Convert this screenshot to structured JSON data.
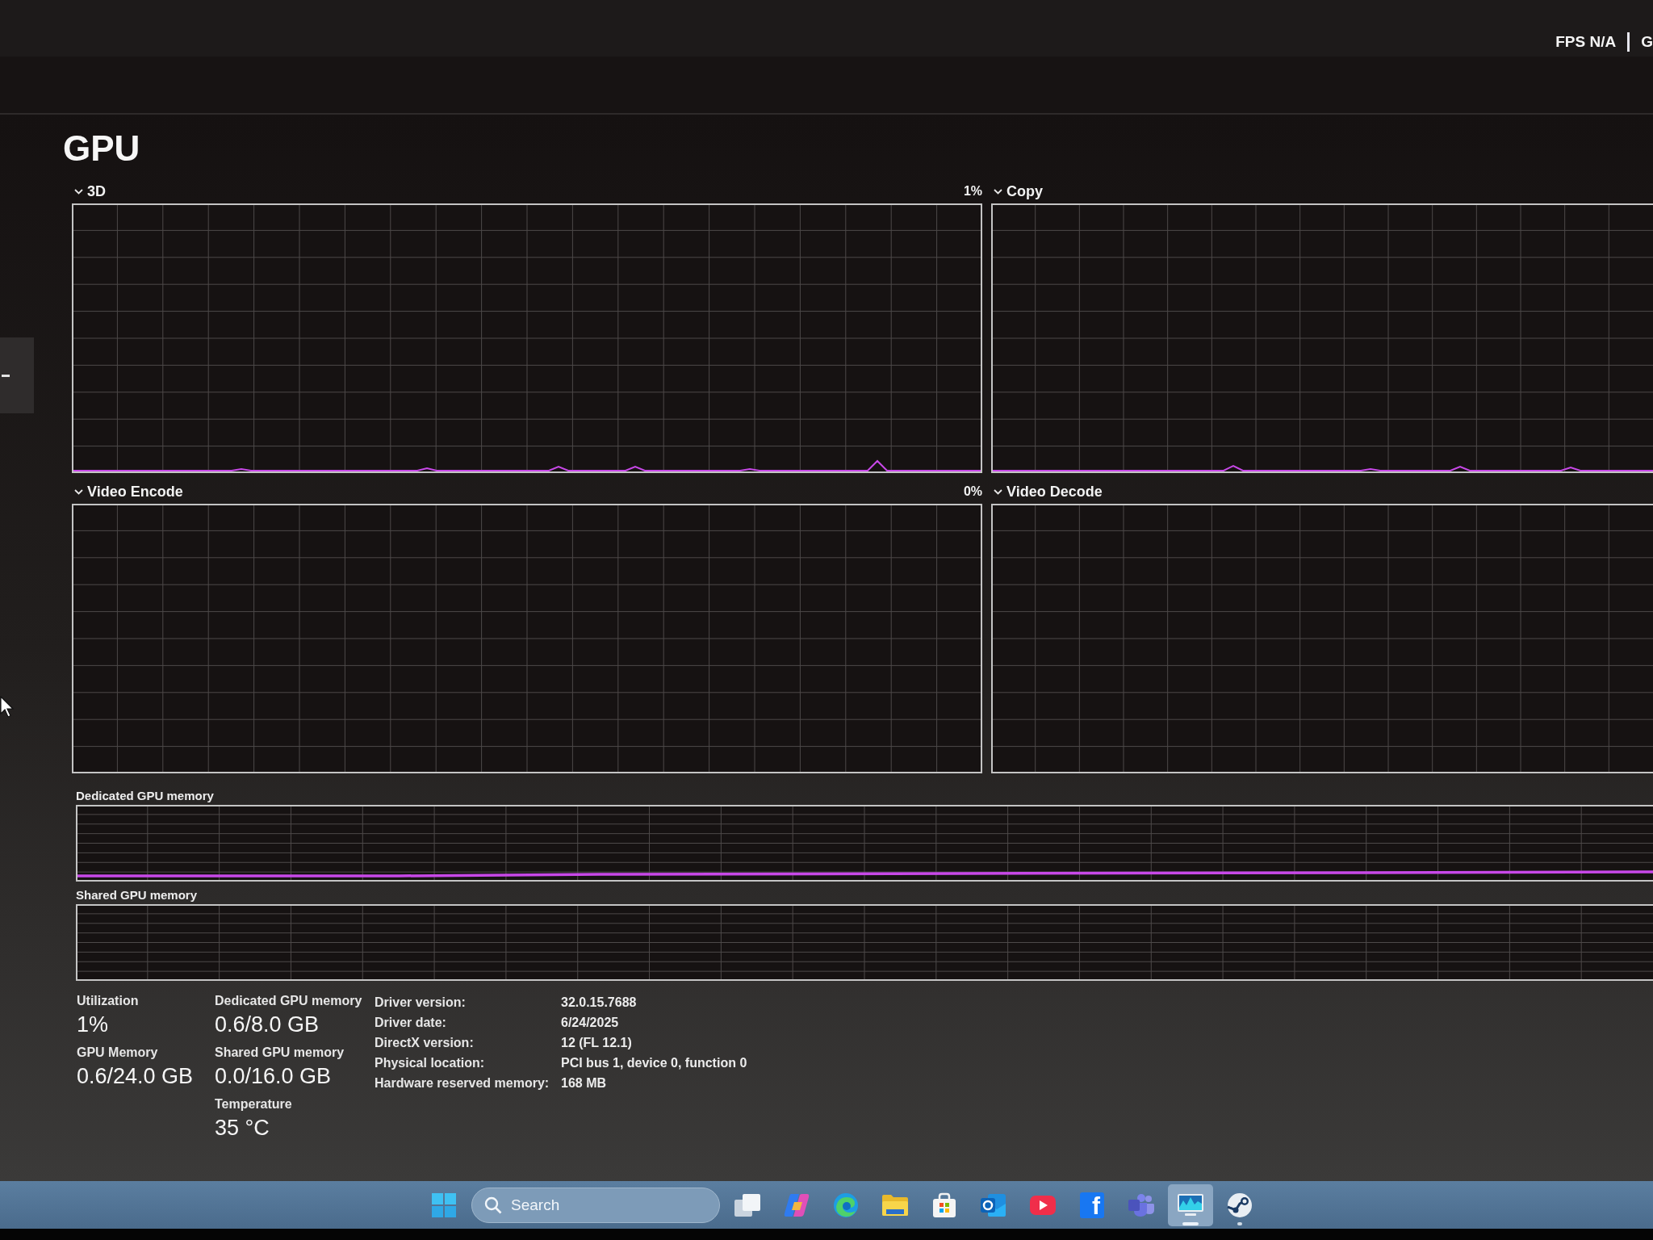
{
  "overlay": {
    "items": [
      {
        "text": "FPS N/A"
      },
      {
        "text": "G"
      }
    ]
  },
  "title": "GPU",
  "engines": [
    {
      "name": "3D",
      "reading": "1%"
    },
    {
      "name": "Copy"
    },
    {
      "name": "Video Encode",
      "reading": "0%"
    },
    {
      "name": "Video Decode"
    }
  ],
  "memory_graphs": [
    {
      "label": "Dedicated GPU memory"
    },
    {
      "label": "Shared GPU memory"
    }
  ],
  "stat_columns": [
    [
      {
        "label": "Utilization",
        "value": "1%"
      },
      {
        "label": "GPU Memory",
        "value": "0.6/24.0 GB"
      }
    ],
    [
      {
        "label": "Dedicated GPU memory",
        "value": "0.6/8.0 GB"
      },
      {
        "label": "Shared GPU memory",
        "value": "0.0/16.0 GB"
      },
      {
        "label": "Temperature",
        "value": "35 °C"
      }
    ]
  ],
  "details": [
    {
      "label": "Driver version:",
      "value": "32.0.15.7688"
    },
    {
      "label": "Driver date:",
      "value": "6/24/2025"
    },
    {
      "label": "DirectX version:",
      "value": "12 (FL 12.1)"
    },
    {
      "label": "Physical location:",
      "value": "PCI bus 1, device 0, function 0"
    },
    {
      "label": "Hardware reserved memory:",
      "value": "168 MB"
    }
  ],
  "taskbar": {
    "search": {
      "placeholder": "Search"
    },
    "apps": [
      {
        "kind": "task-view",
        "selected": false,
        "running": false
      },
      {
        "kind": "copilot",
        "selected": false,
        "running": false
      },
      {
        "kind": "browser",
        "selected": false,
        "running": false
      },
      {
        "kind": "folder",
        "selected": false,
        "running": false
      },
      {
        "kind": "store",
        "selected": false,
        "running": false
      },
      {
        "kind": "mail",
        "selected": false,
        "running": false
      },
      {
        "kind": "video",
        "selected": false,
        "running": false
      },
      {
        "kind": "letter",
        "glyph": "f",
        "selected": false,
        "running": false
      },
      {
        "kind": "people",
        "selected": false,
        "running": false
      },
      {
        "kind": "monitor",
        "selected": true,
        "running": true
      },
      {
        "kind": "game",
        "selected": false,
        "running": true
      }
    ]
  }
}
